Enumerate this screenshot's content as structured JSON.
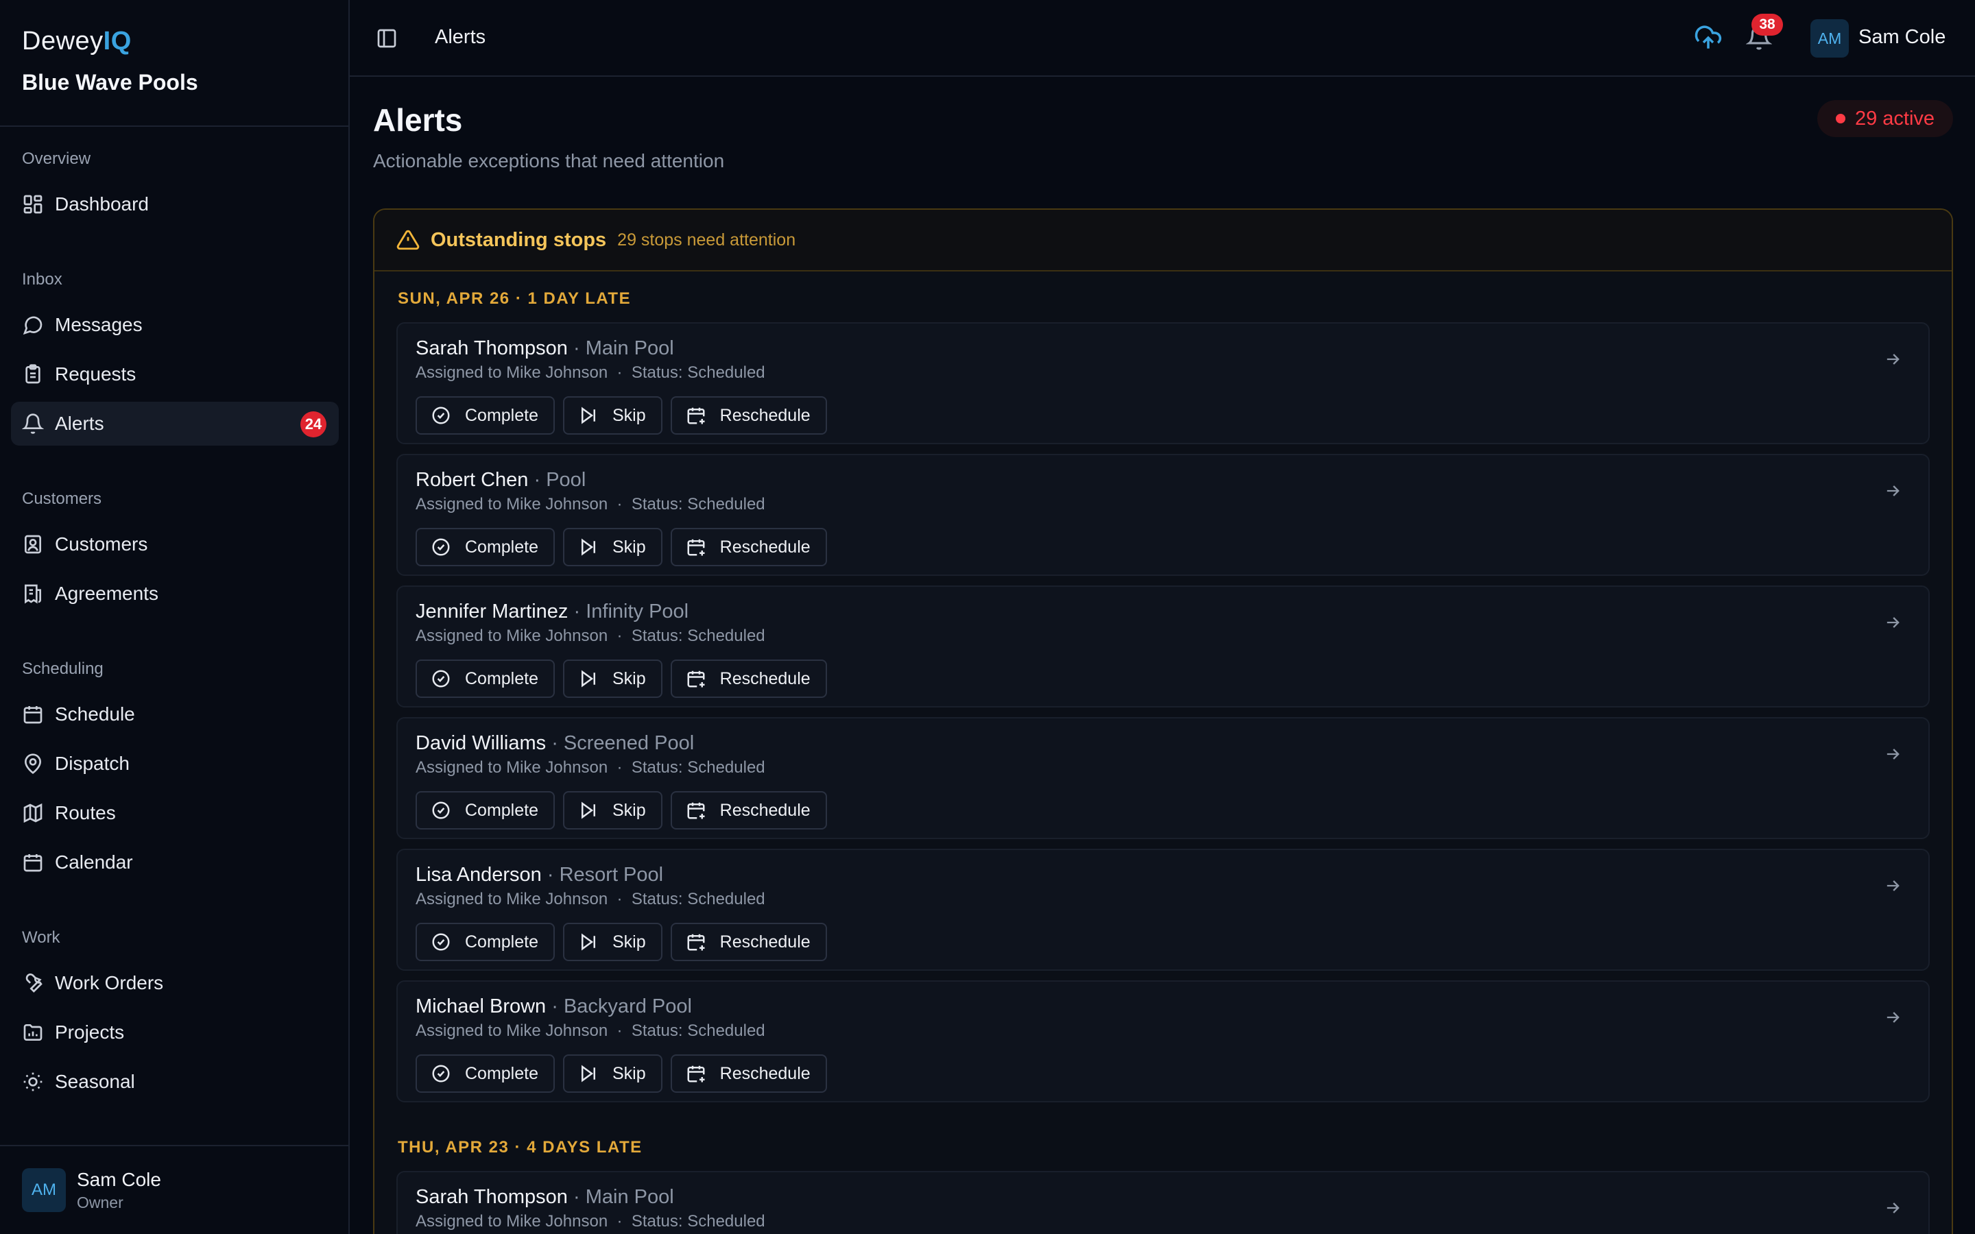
{
  "brand": {
    "logo_word": "Dewey",
    "logo_accent": "IQ",
    "org": "Blue Wave Pools"
  },
  "nav": {
    "overview": "Overview",
    "dashboard": "Dashboard",
    "inbox": "Inbox",
    "messages": "Messages",
    "requests": "Requests",
    "alerts": "Alerts",
    "alerts_count": "24",
    "customers_section": "Customers",
    "customers": "Customers",
    "agreements": "Agreements",
    "scheduling": "Scheduling",
    "schedule": "Schedule",
    "dispatch": "Dispatch",
    "routes": "Routes",
    "calendar": "Calendar",
    "work": "Work",
    "work_orders": "Work Orders",
    "projects": "Projects",
    "seasonal": "Seasonal"
  },
  "user": {
    "initials": "AM",
    "name": "Sam Cole",
    "role": "Owner"
  },
  "topbar": {
    "breadcrumb": "Alerts",
    "notification_count": "38"
  },
  "page": {
    "title": "Alerts",
    "subtitle": "Actionable exceptions that need attention",
    "active_count": "29 active"
  },
  "panel": {
    "title": "Outstanding stops",
    "subtitle": "29 stops need attention"
  },
  "groups": [
    {
      "date": "SUN, APR 26",
      "late": "· 1 DAY LATE"
    },
    {
      "date": "THU, APR 23",
      "late": "· 4 DAYS LATE"
    }
  ],
  "actions": {
    "complete": "Complete",
    "skip": "Skip",
    "reschedule": "Reschedule"
  },
  "stops": [
    {
      "name": "Sarah Thompson",
      "pool": "· Main Pool",
      "assigned": "Assigned to Mike Johnson",
      "status": "Status: Scheduled"
    },
    {
      "name": "Robert Chen",
      "pool": "· Pool",
      "assigned": "Assigned to Mike Johnson",
      "status": "Status: Scheduled"
    },
    {
      "name": "Jennifer Martinez",
      "pool": "· Infinity Pool",
      "assigned": "Assigned to Mike Johnson",
      "status": "Status: Scheduled"
    },
    {
      "name": "David Williams",
      "pool": "· Screened Pool",
      "assigned": "Assigned to Mike Johnson",
      "status": "Status: Scheduled"
    },
    {
      "name": "Lisa Anderson",
      "pool": "· Resort Pool",
      "assigned": "Assigned to Mike Johnson",
      "status": "Status: Scheduled"
    },
    {
      "name": "Michael Brown",
      "pool": "· Backyard Pool",
      "assigned": "Assigned to Mike Johnson",
      "status": "Status: Scheduled"
    },
    {
      "name": "Sarah Thompson",
      "pool": "· Main Pool",
      "assigned": "Assigned to Mike Johnson",
      "status": "Status: Scheduled"
    }
  ],
  "colors": {
    "accent": "#3aa3e0",
    "danger": "#e0242f",
    "warning": "#f2b53a"
  }
}
